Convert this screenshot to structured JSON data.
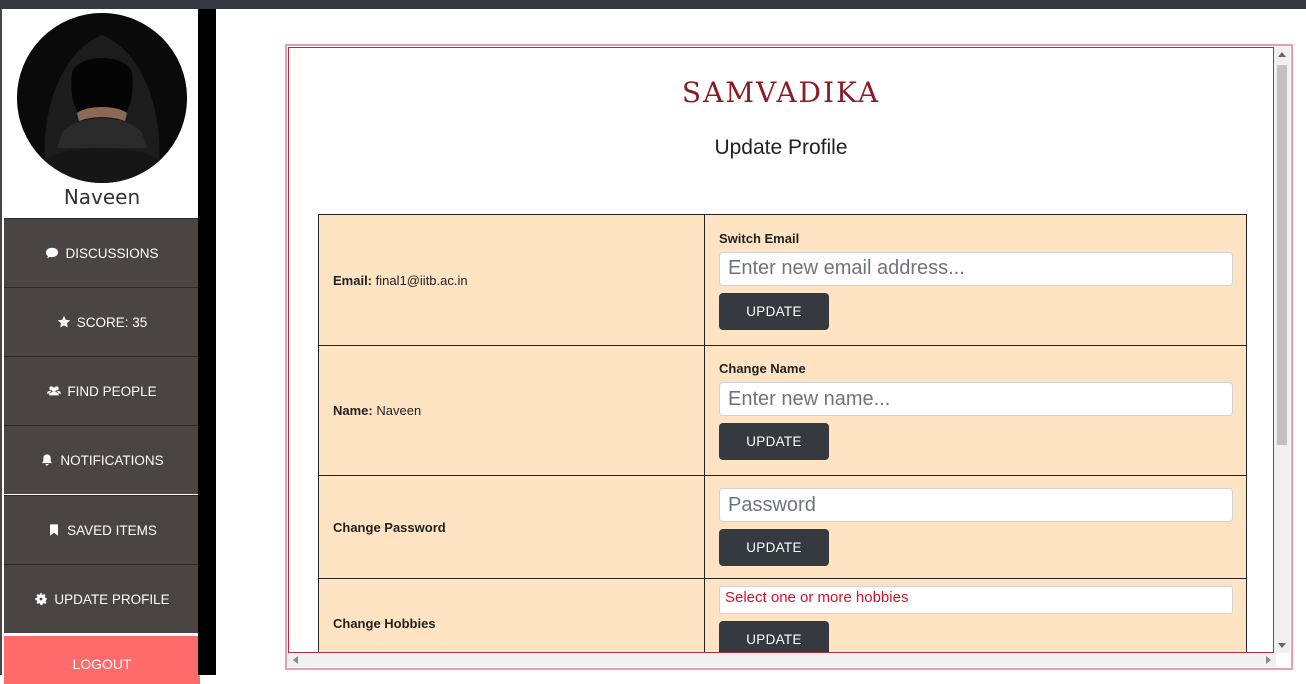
{
  "sidebar": {
    "username": "Naveen",
    "items": [
      {
        "label": "DISCUSSIONS",
        "icon": "comment-icon"
      },
      {
        "label": "SCORE: 35",
        "icon": "star-icon"
      },
      {
        "label": "FIND PEOPLE",
        "icon": "users-icon"
      },
      {
        "label": "NOTIFICATIONS",
        "icon": "bell-icon"
      },
      {
        "label": "SAVED ITEMS",
        "icon": "bookmark-icon"
      },
      {
        "label": "UPDATE PROFILE",
        "icon": "gear-icon"
      }
    ],
    "logout_label": "LOGOUT"
  },
  "main": {
    "brand": "SAMVADIKA",
    "title": "Update Profile",
    "rows": {
      "email": {
        "label": "Email:",
        "value": "final1@iitb.ac.in",
        "field_label": "Switch Email",
        "placeholder": "Enter new email address...",
        "button": "UPDATE"
      },
      "name": {
        "label": "Name:",
        "value": "Naveen",
        "field_label": "Change Name",
        "placeholder": "Enter new name...",
        "button": "UPDATE"
      },
      "password": {
        "label": "Change Password",
        "placeholder": "Password",
        "button": "UPDATE"
      },
      "hobbies": {
        "label": "Change Hobbies",
        "placeholder": "Select one or more hobbies",
        "button": "UPDATE"
      }
    }
  },
  "colors": {
    "sidebar_bg": "#4a4542",
    "logout_bg": "#ff6b6b",
    "brand": "#8b1c24",
    "table_bg": "#ffe4c4",
    "button_bg": "#343a40"
  }
}
